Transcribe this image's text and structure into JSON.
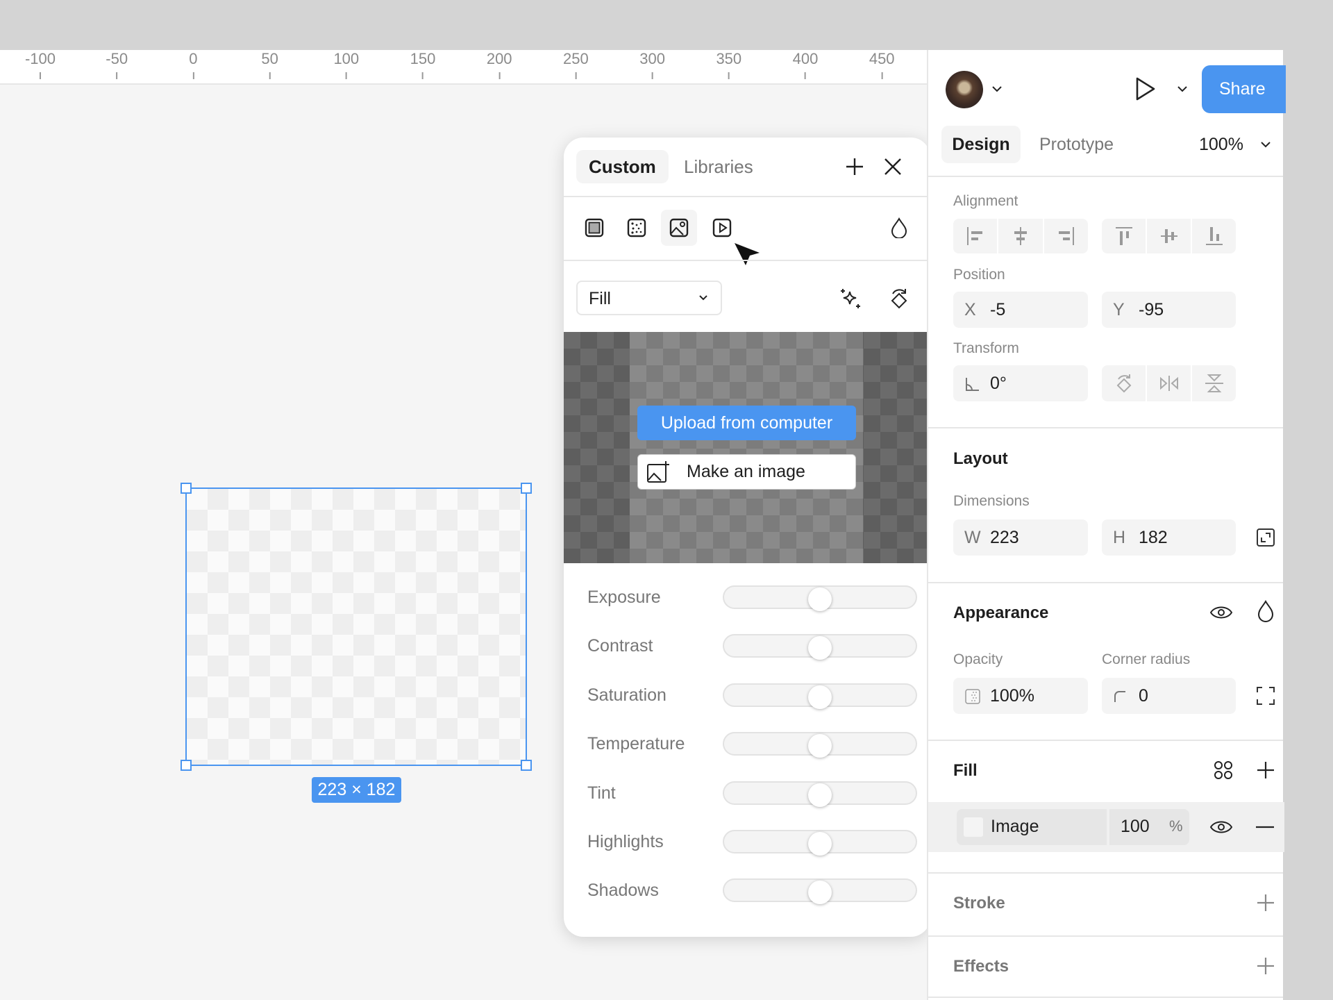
{
  "ruler": {
    "ticks": [
      "-100",
      "-50",
      "0",
      "50",
      "100",
      "150",
      "200",
      "250",
      "300",
      "350",
      "400",
      "450"
    ]
  },
  "frame": {
    "dimensions_label": "223 × 182"
  },
  "popup": {
    "tabs": [
      {
        "label": "Custom",
        "active": true
      },
      {
        "label": "Libraries",
        "active": false
      }
    ],
    "fill_types": [
      "solid-fill-icon",
      "pattern-fill-icon",
      "image-fill-icon",
      "video-fill-icon"
    ],
    "selected_fill_type": "image-fill-icon",
    "mode_select": "Fill",
    "upload_label": "Upload from computer",
    "make_image_label": "Make an image",
    "adjustments": [
      {
        "label": "Exposure",
        "value": 0
      },
      {
        "label": "Contrast",
        "value": 0
      },
      {
        "label": "Saturation",
        "value": 0
      },
      {
        "label": "Temperature",
        "value": 0
      },
      {
        "label": "Tint",
        "value": 0
      },
      {
        "label": "Highlights",
        "value": 0
      },
      {
        "label": "Shadows",
        "value": 0
      }
    ]
  },
  "panel": {
    "share_label": "Share",
    "tabs": [
      {
        "label": "Design",
        "active": true
      },
      {
        "label": "Prototype",
        "active": false
      }
    ],
    "zoom": "100%",
    "alignment_label": "Alignment",
    "position_label": "Position",
    "x_prefix": "X",
    "x_value": "-5",
    "y_prefix": "Y",
    "y_value": "-95",
    "transform_label": "Transform",
    "rotation": "0°",
    "layout_label": "Layout",
    "dimensions_label": "Dimensions",
    "w_prefix": "W",
    "w_value": "223",
    "h_prefix": "H",
    "h_value": "182",
    "appearance_label": "Appearance",
    "opacity_label": "Opacity",
    "opacity_value": "100%",
    "corner_label": "Corner radius",
    "corner_value": "0",
    "fill_label": "Fill",
    "fill_type": "Image",
    "fill_opacity": "100",
    "fill_percent": "%",
    "stroke_label": "Stroke",
    "effects_label": "Effects"
  },
  "colors": {
    "accent": "#4a95f0",
    "canvas": "#f5f5f5"
  }
}
